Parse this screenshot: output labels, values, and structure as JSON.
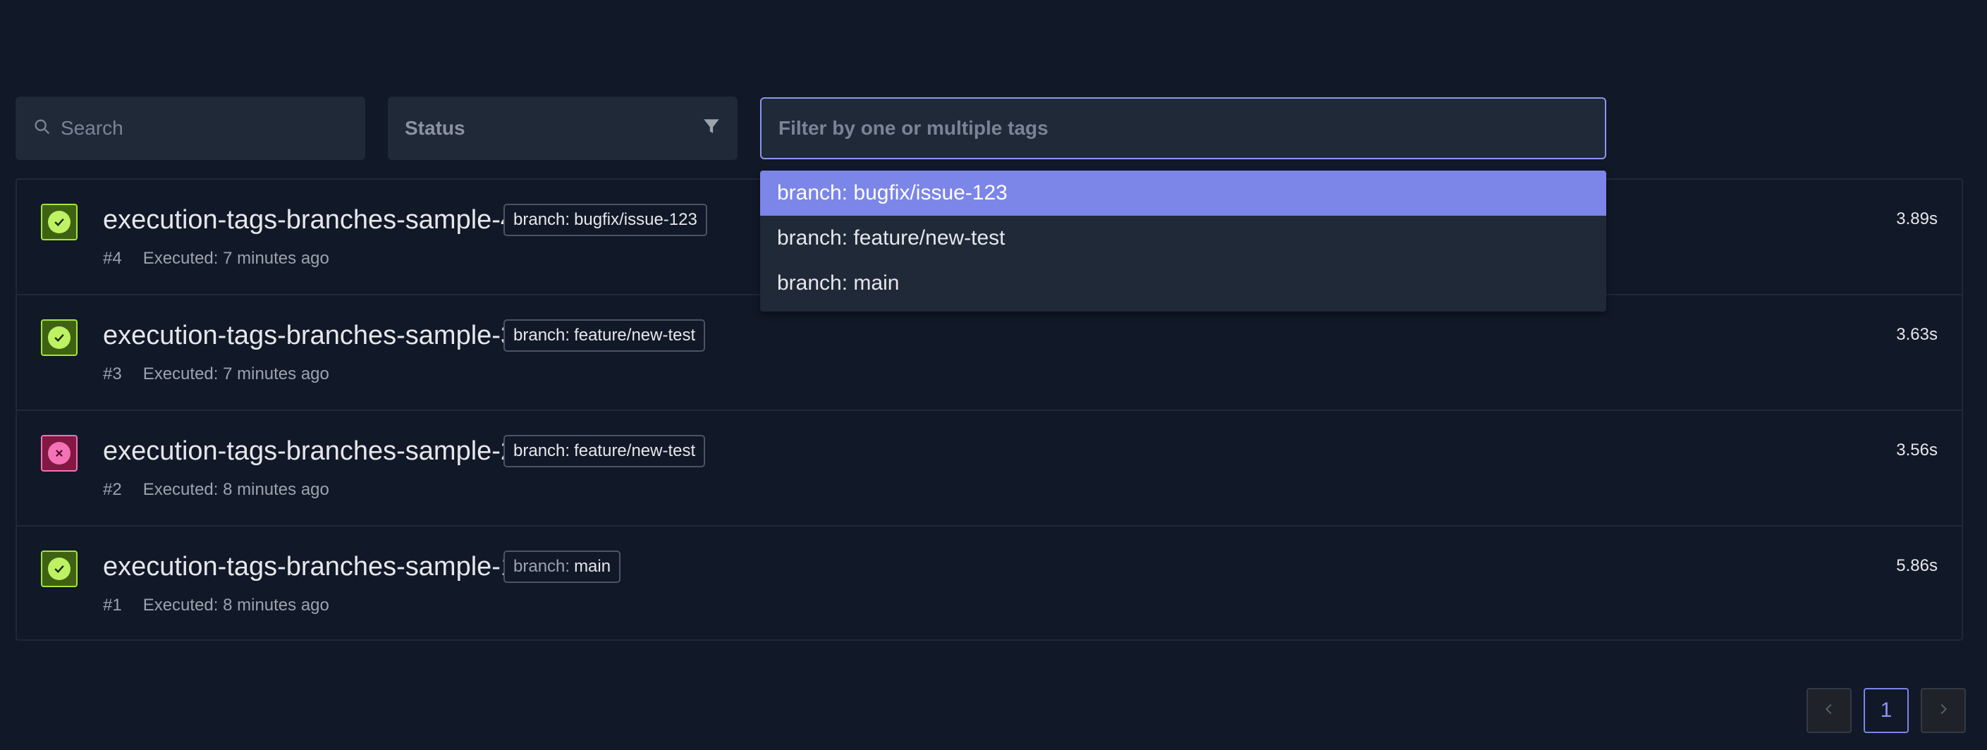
{
  "search": {
    "placeholder": "Search"
  },
  "status_filter": {
    "label": "Status"
  },
  "tag_filter": {
    "placeholder": "Filter by one or multiple tags",
    "options": [
      {
        "label": "branch: bugfix/issue-123",
        "active": true
      },
      {
        "label": "branch: feature/new-test",
        "active": false
      },
      {
        "label": "branch: main",
        "active": false
      }
    ]
  },
  "executions": [
    {
      "name": "execution-tags-branches-sample-4",
      "tag_key": "branch:",
      "tag_value": "bugfix/issue-123",
      "number": "#4",
      "executed": "Executed: 7 minutes ago",
      "duration": "3.89s",
      "status": "passed"
    },
    {
      "name": "execution-tags-branches-sample-3",
      "tag_key": "branch:",
      "tag_value": "feature/new-test",
      "number": "#3",
      "executed": "Executed: 7 minutes ago",
      "duration": "3.63s",
      "status": "passed"
    },
    {
      "name": "execution-tags-branches-sample-2",
      "tag_key": "branch:",
      "tag_value": "feature/new-test",
      "number": "#2",
      "executed": "Executed: 8 minutes ago",
      "duration": "3.56s",
      "status": "failed"
    },
    {
      "name": "execution-tags-branches-sample-1",
      "tag_key": "branch:",
      "tag_value": "main",
      "number": "#1",
      "executed": "Executed: 8 minutes ago",
      "duration": "5.86s",
      "status": "passed"
    }
  ],
  "pagination": {
    "current_page": "1"
  },
  "colors": {
    "background": "#111827",
    "surface": "#1f2937",
    "accent": "#7c85e8",
    "passed": "#bef264",
    "failed": "#f472b6"
  }
}
